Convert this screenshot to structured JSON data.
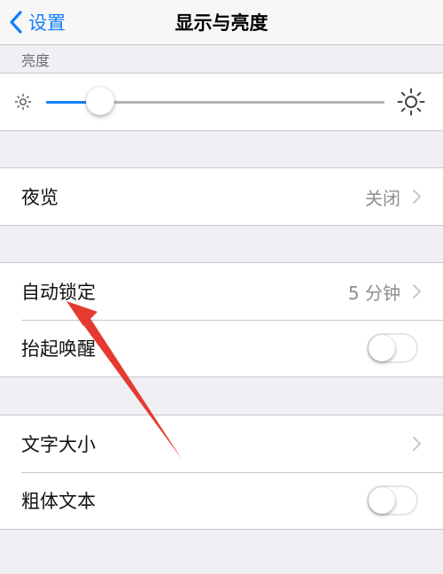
{
  "navbar": {
    "back_label": "设置",
    "title": "显示与亮度"
  },
  "brightness": {
    "header": "亮度",
    "level": 0.16
  },
  "night_shift": {
    "label": "夜览",
    "value": "关闭"
  },
  "auto_lock": {
    "label": "自动锁定",
    "value": "5 分钟"
  },
  "raise_to_wake": {
    "label": "抬起唤醒",
    "on": false
  },
  "text_size": {
    "label": "文字大小"
  },
  "bold_text": {
    "label": "粗体文本",
    "on": false
  },
  "colors": {
    "accent": "#157efb",
    "annotation_arrow": "#e53a2f"
  }
}
